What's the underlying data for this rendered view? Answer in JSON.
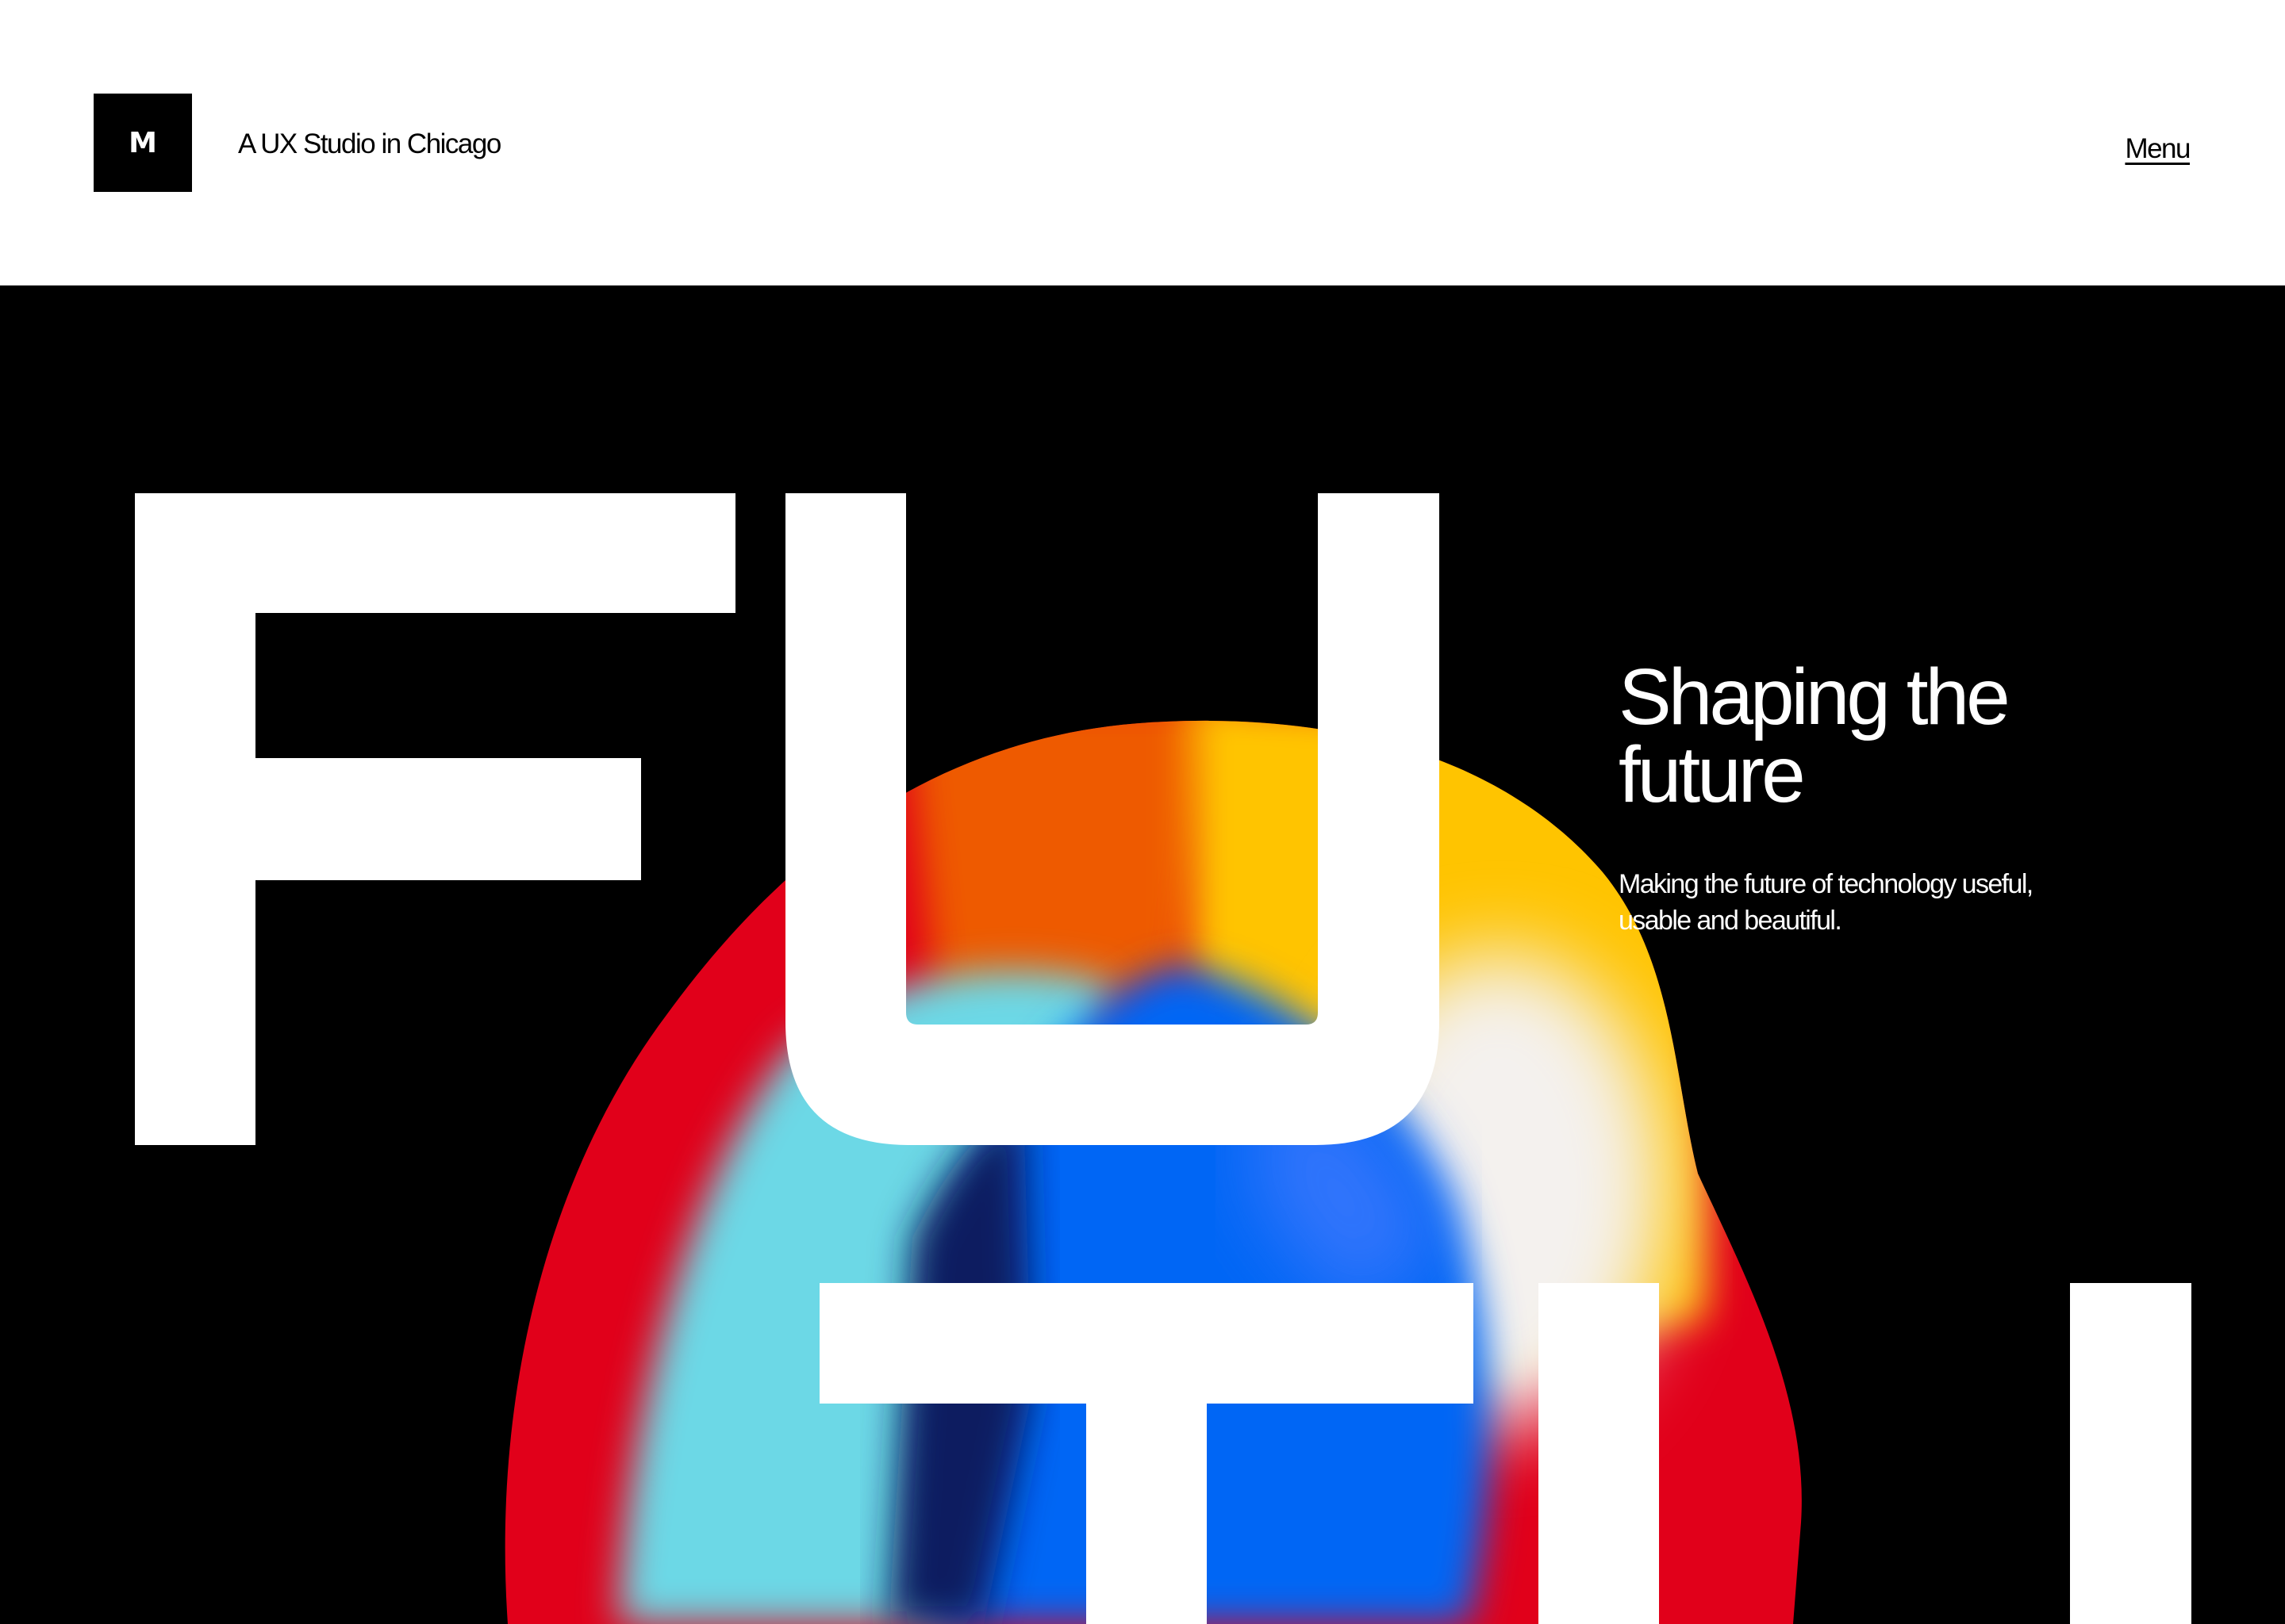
{
  "header": {
    "logo_letter": "M",
    "tagline": "A UX Studio in Chicago",
    "menu_label": "Menu"
  },
  "hero": {
    "heading": "Shaping the future",
    "description": "Making the future of technology useful, usable and beautiful.",
    "big_word_visible": "FUTU"
  },
  "colors": {
    "background": "#000000",
    "foreground": "#ffffff",
    "blob_red": "#e1001a",
    "blob_cyan": "#6cd8e6",
    "blob_blue": "#0066f5",
    "blob_yellow": "#ffc400"
  }
}
